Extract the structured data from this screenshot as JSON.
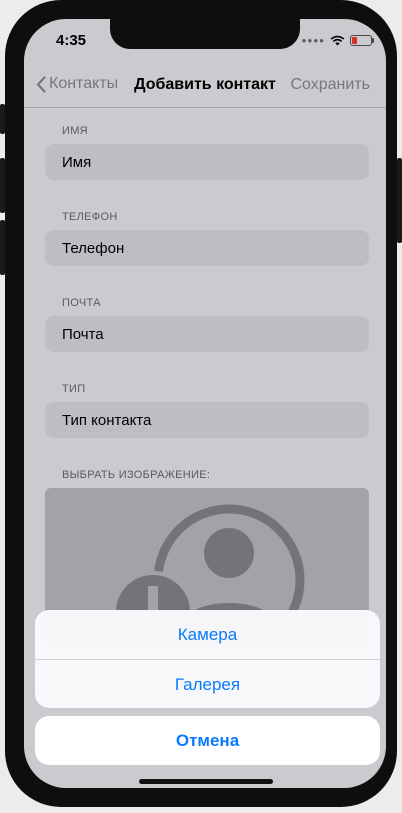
{
  "status": {
    "time": "4:35",
    "battery_level": 0.3
  },
  "nav": {
    "back_label": "Контакты",
    "title": "Добавить контакт",
    "save_label": "Сохранить"
  },
  "form": {
    "name": {
      "label": "ИМЯ",
      "placeholder": "Имя"
    },
    "phone": {
      "label": "ТЕЛЕФОН",
      "placeholder": "Телефон"
    },
    "email": {
      "label": "ПОЧТА",
      "placeholder": "Почта"
    },
    "type": {
      "label": "ТИП",
      "placeholder": "Тип контакта"
    },
    "image": {
      "label": "ВЫБРАТЬ ИЗОБРАЖЕНИЕ:"
    }
  },
  "action_sheet": {
    "camera": "Камера",
    "gallery": "Галерея",
    "cancel": "Отмена"
  }
}
